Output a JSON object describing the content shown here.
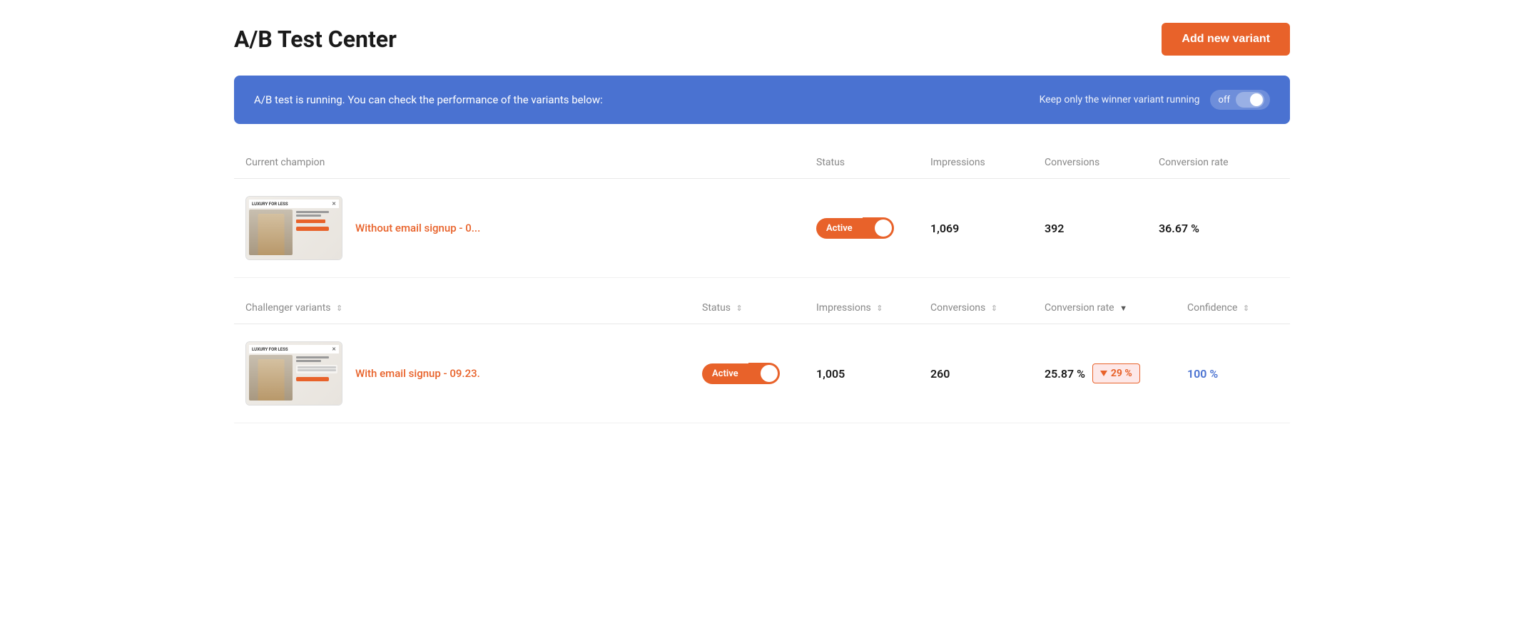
{
  "page": {
    "title": "A/B Test Center",
    "add_variant_btn": "Add new variant"
  },
  "banner": {
    "text": "A/B test is running. You can check the performance of the variants below:",
    "winner_label": "Keep only the winner variant running",
    "toggle_label": "off"
  },
  "champion_table": {
    "headers": {
      "champion": "Current champion",
      "status": "Status",
      "impressions": "Impressions",
      "conversions": "Conversions",
      "conversion_rate": "Conversion rate"
    },
    "row": {
      "name": "Without email signup - 0...",
      "status": "Active",
      "impressions": "1,069",
      "conversions": "392",
      "conversion_rate": "36.67 %"
    }
  },
  "challenger_table": {
    "headers": {
      "variants": "Challenger variants",
      "status": "Status",
      "impressions": "Impressions",
      "conversions": "Conversions",
      "conversion_rate": "Conversion rate",
      "confidence": "Confidence"
    },
    "row": {
      "name": "With email signup - 09.23.",
      "status": "Active",
      "impressions": "1,005",
      "conversions": "260",
      "conversion_rate": "25.87 %",
      "conversion_badge": "↓ 29 %",
      "confidence": "100 %"
    }
  }
}
